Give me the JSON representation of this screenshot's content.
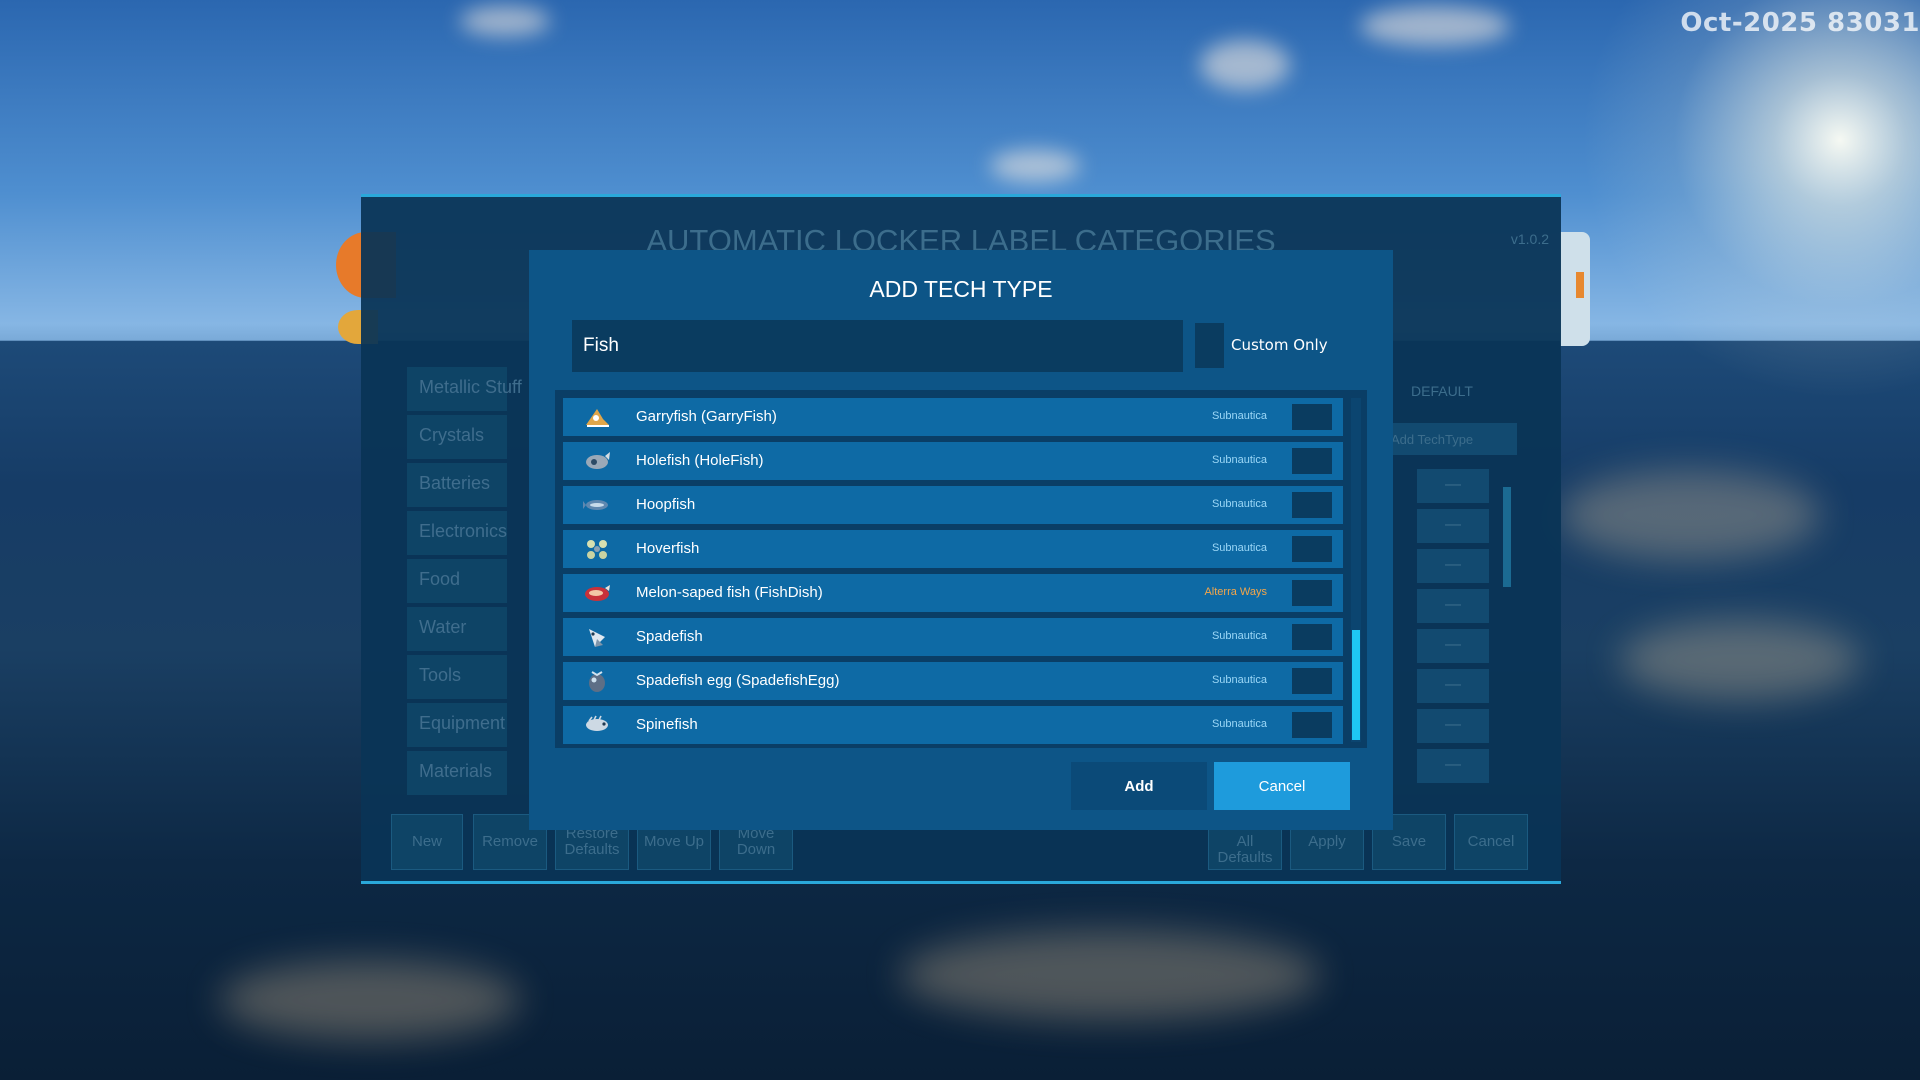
{
  "watermark": "Oct-2025 83031",
  "main_window": {
    "title": "AUTOMATIC LOCKER LABEL CATEGORIES",
    "version": "v1.0.2",
    "categories": [
      "Metallic Stuff",
      "Crystals",
      "Batteries",
      "Electronics",
      "Food",
      "Water",
      "Tools",
      "Equipment",
      "Materials"
    ],
    "default_label": "DEFAULT",
    "add_techtype_label": "Add TechType",
    "dash_symbol": "—",
    "bottom_buttons": [
      "New",
      "Remove",
      "Restore Defaults",
      "Move Up",
      "Move Down",
      "Restore All Defaults",
      "Apply",
      "Save",
      "Cancel"
    ]
  },
  "dialog": {
    "title": "ADD TECH TYPE",
    "search_value": "Fish",
    "custom_only_label": "Custom Only",
    "items": [
      {
        "name": "Garryfish  (GarryFish)",
        "source": "Subnautica",
        "icon": "garryfish-icon"
      },
      {
        "name": "Holefish  (HoleFish)",
        "source": "Subnautica",
        "icon": "holefish-icon"
      },
      {
        "name": "Hoopfish",
        "source": "Subnautica",
        "icon": "hoopfish-icon"
      },
      {
        "name": "Hoverfish",
        "source": "Subnautica",
        "icon": "hoverfish-icon"
      },
      {
        "name": "Melon-saped fish  (FishDish)",
        "source": "Alterra Ways",
        "icon": "fishdish-icon"
      },
      {
        "name": "Spadefish",
        "source": "Subnautica",
        "icon": "spadefish-icon"
      },
      {
        "name": "Spadefish egg  (SpadefishEgg)",
        "source": "Subnautica",
        "icon": "spadefish-egg-icon"
      },
      {
        "name": "Spinefish",
        "source": "Subnautica",
        "icon": "spinefish-icon"
      }
    ],
    "add_button": "Add",
    "cancel_button": "Cancel"
  },
  "colors": {
    "modal_bg": "#0d5587",
    "row_bg": "#0e6aa5",
    "source_default": "#9bd7f7",
    "source_mod": "#f4a64a",
    "cancel_accent": "#1e9bdc",
    "scroll_thumb": "#1ec7f2"
  }
}
